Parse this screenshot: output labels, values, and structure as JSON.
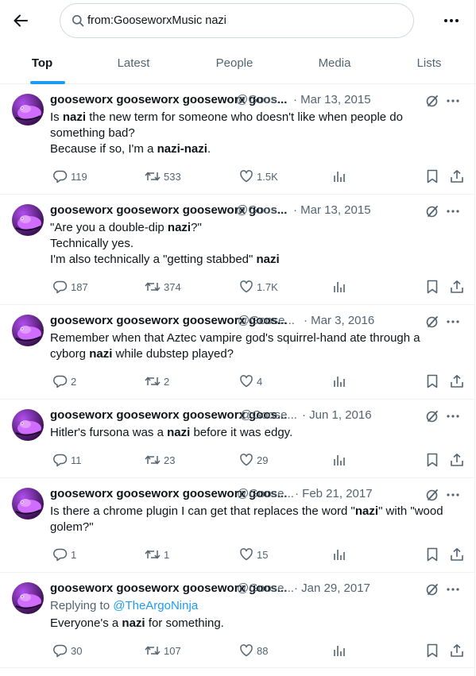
{
  "search": {
    "query": "from:GooseworxMusic nazi"
  },
  "tabs": [
    "Top",
    "Latest",
    "People",
    "Media",
    "Lists"
  ],
  "active_tab": "Top",
  "tweets": [
    {
      "name": "gooseworx gooseworx gooseworx goos...",
      "handle": "@Goos...",
      "date": "· Mar 13, 2015",
      "lines": [
        [
          {
            "t": "Is "
          },
          {
            "t": "nazi",
            "b": true
          },
          {
            "t": " the new term for someone who doesn't like when people do"
          }
        ],
        [
          {
            "t": "something bad?"
          }
        ],
        [
          {
            "t": "Because if so, I'm a "
          },
          {
            "t": "nazi-nazi",
            "b": true
          },
          {
            "t": "."
          }
        ]
      ],
      "replies": "119",
      "reposts": "533",
      "likes": "1.5K"
    },
    {
      "name": "gooseworx gooseworx gooseworx goos...",
      "handle": "@Goos...",
      "date": "· Mar 13, 2015",
      "lines": [
        [
          {
            "t": "\"Are you a double-dip "
          },
          {
            "t": "nazi",
            "b": true
          },
          {
            "t": "?\""
          }
        ],
        [
          {
            "t": "Technically yes."
          }
        ],
        [
          {
            "t": "I'm also technically a \"getting stabbed\" "
          },
          {
            "t": "nazi",
            "b": true
          }
        ]
      ],
      "replies": "187",
      "reposts": "374",
      "likes": "1.7K"
    },
    {
      "name": "gooseworx gooseworx gooseworx goos...",
      "handle": "@Goose...",
      "date": "· Mar 3, 2016",
      "lines": [
        [
          {
            "t": "Remember when that Aztec vampire god's squirrel-hand ate through a"
          }
        ],
        [
          {
            "t": "cyborg "
          },
          {
            "t": "nazi",
            "b": true
          },
          {
            "t": " while dubstep played?"
          }
        ]
      ],
      "replies": "2",
      "reposts": "2",
      "likes": "4"
    },
    {
      "name": "gooseworx gooseworx gooseworx goos...",
      "handle": "@Goose...",
      "date": "· Jun 1, 2016",
      "lines": [
        [
          {
            "t": "Hitler's fursona was a "
          },
          {
            "t": "nazi",
            "b": true
          },
          {
            "t": " before it was edgy."
          }
        ]
      ],
      "replies": "11",
      "reposts": "23",
      "likes": "29"
    },
    {
      "name": "gooseworx gooseworx gooseworx goos...",
      "handle": "@Goose...",
      "date": "· Feb 21, 2017",
      "lines": [
        [
          {
            "t": "Is there a chrome plugin I can get that replaces the word \""
          },
          {
            "t": "nazi",
            "b": true
          },
          {
            "t": "\" with \"wood"
          }
        ],
        [
          {
            "t": "golem?\""
          }
        ]
      ],
      "replies": "1",
      "reposts": "1",
      "likes": "15"
    },
    {
      "name": "gooseworx gooseworx gooseworx goos...",
      "handle": "@Goose...",
      "date": "· Jan 29, 2017",
      "reply_prefix": "Replying to ",
      "reply_to": "@TheArgoNinja",
      "lines": [
        [
          {
            "t": "Everyone's a "
          },
          {
            "t": "nazi",
            "b": true
          },
          {
            "t": " for something."
          }
        ]
      ],
      "replies": "30",
      "reposts": "107",
      "likes": "88"
    }
  ],
  "colors": {
    "accent": "#1d9bf0",
    "text": "#0f1419",
    "muted": "#536471",
    "border": "#eff3f4"
  }
}
